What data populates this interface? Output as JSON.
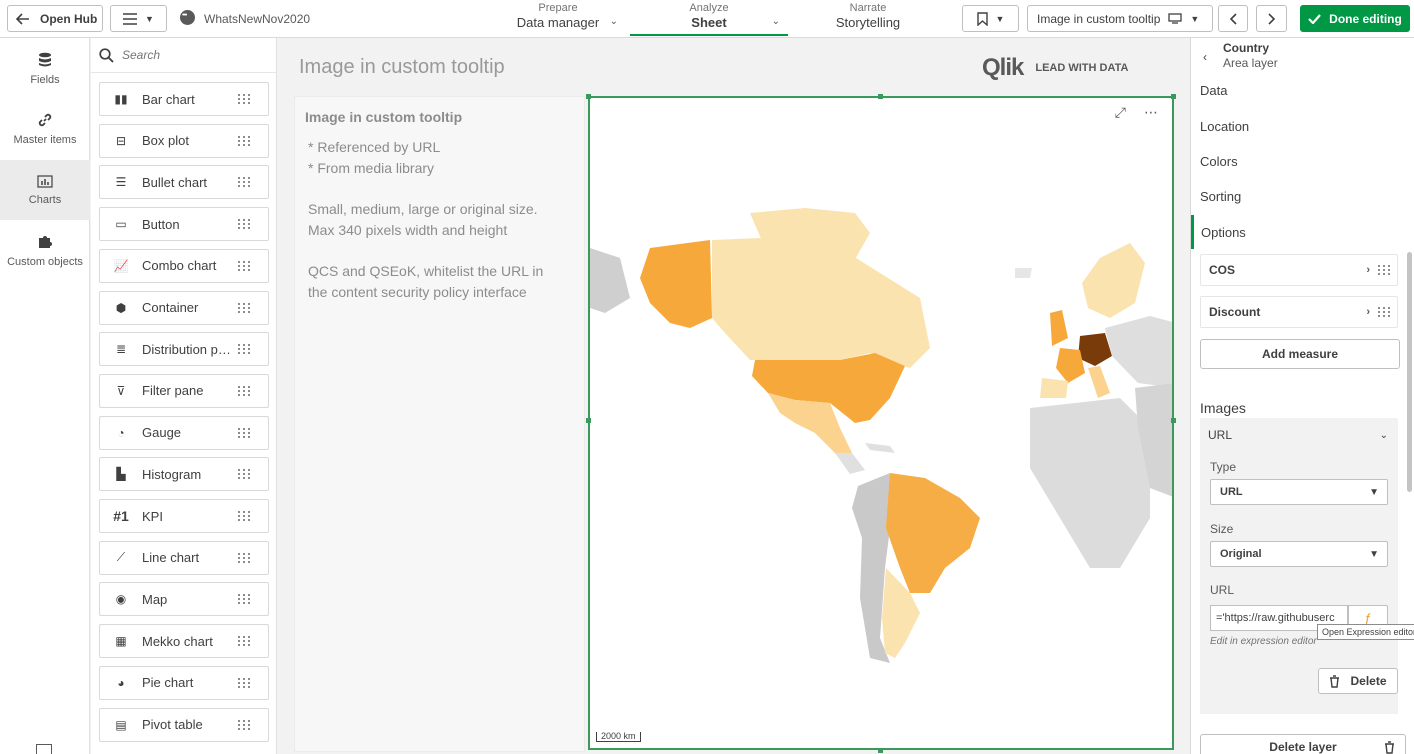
{
  "topbar": {
    "open_hub": "Open Hub",
    "app_name": "WhatsNewNov2020",
    "tabs": [
      {
        "small": "Prepare",
        "main": "Data manager"
      },
      {
        "small": "Analyze",
        "main": "Sheet"
      },
      {
        "small": "Narrate",
        "main": "Storytelling"
      }
    ],
    "sheet_selector": "Image in custom tooltip",
    "done_editing": "Done editing"
  },
  "leftnav": {
    "items": [
      {
        "label": "Fields",
        "icon": "database-icon"
      },
      {
        "label": "Master items",
        "icon": "link-icon"
      },
      {
        "label": "Charts",
        "icon": "bar-chart-icon"
      },
      {
        "label": "Custom objects",
        "icon": "puzzle-icon"
      }
    ]
  },
  "charts": {
    "search_placeholder": "Search",
    "items": [
      {
        "label": "Bar chart",
        "icon": "bar-chart-icon"
      },
      {
        "label": "Box plot",
        "icon": "box-plot-icon"
      },
      {
        "label": "Bullet chart",
        "icon": "bullet-chart-icon"
      },
      {
        "label": "Button",
        "icon": "button-icon"
      },
      {
        "label": "Combo chart",
        "icon": "combo-chart-icon"
      },
      {
        "label": "Container",
        "icon": "container-icon"
      },
      {
        "label": "Distribution p…",
        "icon": "distribution-plot-icon"
      },
      {
        "label": "Filter pane",
        "icon": "filter-pane-icon"
      },
      {
        "label": "Gauge",
        "icon": "gauge-icon"
      },
      {
        "label": "Histogram",
        "icon": "histogram-icon"
      },
      {
        "label": "KPI",
        "icon": "kpi-icon",
        "glyph": "#1"
      },
      {
        "label": "Line chart",
        "icon": "line-chart-icon"
      },
      {
        "label": "Map",
        "icon": "globe-icon"
      },
      {
        "label": "Mekko chart",
        "icon": "mekko-chart-icon"
      },
      {
        "label": "Pie chart",
        "icon": "pie-chart-icon"
      },
      {
        "label": "Pivot table",
        "icon": "pivot-table-icon"
      }
    ]
  },
  "sheet": {
    "title": "Image in custom tooltip",
    "logo": "Qlik",
    "logo_tag": "LEAD WITH DATA",
    "text_object": {
      "heading": "Image in custom tooltip",
      "lines1": [
        "* Referenced by URL",
        "* From media library"
      ],
      "lines2": [
        "Small, medium, large or original size.",
        "Max 340 pixels width and height"
      ],
      "lines3": [
        "QCS and QSEoK, whitelist the URL in",
        "the content security policy interface"
      ]
    },
    "map": {
      "scale": "2000 km"
    }
  },
  "props": {
    "title": "Country",
    "subtitle": "Area layer",
    "sections": [
      "Data",
      "Location",
      "Colors",
      "Sorting",
      "Options"
    ],
    "measures": [
      "COS",
      "Discount"
    ],
    "add_measure": "Add measure",
    "images_heading": "Images",
    "url_header": "URL",
    "type_label": "Type",
    "type_value": "URL",
    "size_label": "Size",
    "size_value": "Original",
    "url_label": "URL",
    "url_value": "='https://raw.githubuserc",
    "hint": "Edit in expression editor",
    "tooltip": "Open Expression editor",
    "delete": "Delete",
    "delete_layer": "Delete layer"
  }
}
